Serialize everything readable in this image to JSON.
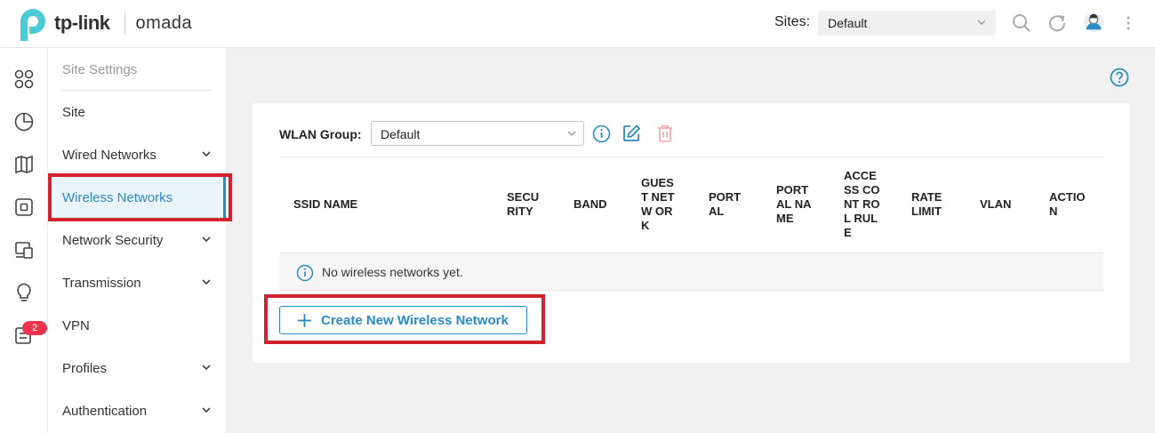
{
  "header": {
    "brand": "tp-link",
    "product": "omada",
    "sites_label": "Sites:",
    "sites_value": "Default"
  },
  "rail": {
    "icons": [
      "dashboard-icon",
      "statistics-icon",
      "map-icon",
      "devices-icon",
      "insights-icon",
      "hotspot-icon",
      "logs-icon"
    ],
    "logs_badge": "2"
  },
  "sidebar": {
    "title": "Site Settings",
    "items": [
      {
        "label": "Site",
        "expandable": false
      },
      {
        "label": "Wired Networks",
        "expandable": true
      },
      {
        "label": "Wireless Networks",
        "expandable": false,
        "active": true
      },
      {
        "label": "Network Security",
        "expandable": true
      },
      {
        "label": "Transmission",
        "expandable": true
      },
      {
        "label": "VPN",
        "expandable": false
      },
      {
        "label": "Profiles",
        "expandable": true
      },
      {
        "label": "Authentication",
        "expandable": true
      }
    ]
  },
  "main": {
    "wlan_group_label": "WLAN Group:",
    "wlan_group_value": "Default",
    "columns": [
      "SSID NAME",
      "SECU RITY",
      "BAND",
      "GUES T NETW ORK",
      "PORT AL",
      "PORT AL NAME",
      "ACCE SS CONT ROL RULE",
      "RATE LIMIT",
      "VLAN",
      "ACTIO N"
    ],
    "empty_message": "No wireless networks yet.",
    "create_button": "Create New Wireless Network"
  },
  "colors": {
    "accent": "#2b8bc4",
    "brand_teal": "#4acbd6",
    "highlight_red": "#d2222d",
    "badge_red": "#f0344e"
  }
}
